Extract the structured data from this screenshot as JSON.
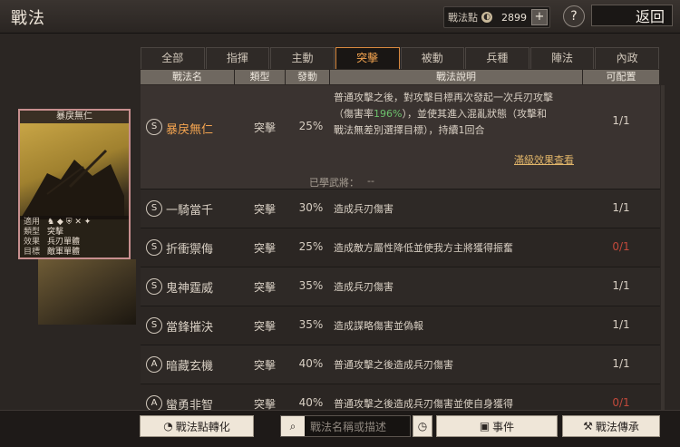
{
  "header": {
    "title": "戰法",
    "points_label": "戰法點",
    "points_value": "2899",
    "points_plus": "+",
    "help": "?",
    "back_label": "返回"
  },
  "tabs": [
    "全部",
    "指揮",
    "主動",
    "突擊",
    "被動",
    "兵種",
    "陣法",
    "內政"
  ],
  "active_tab": "突擊",
  "columns": [
    "戰法名",
    "類型",
    "發動",
    "戰法說明",
    "可配置"
  ],
  "expanded": {
    "badge": "S",
    "name": "暴戾無仁",
    "type": "突擊",
    "rate": "25%",
    "desc_1": "普通攻擊之後，對攻擊目標再次發起一次兵刃攻擊",
    "desc_2a": "（傷害率",
    "desc_2b": "196%",
    "desc_2c": "），並使其進入混亂狀態（攻擊和",
    "desc_3": "戰法無差別選擇目標），持續1回合",
    "config": "1/1",
    "full_effect_link": "滿級效果查看",
    "learned_label": "已學武將：",
    "learned_value": "--"
  },
  "rows": [
    {
      "badge": "S",
      "name": "一騎當千",
      "type": "突擊",
      "rate": "30%",
      "desc": "造成兵刃傷害",
      "config": "1/1",
      "red": false
    },
    {
      "badge": "S",
      "name": "折衝禦侮",
      "type": "突擊",
      "rate": "25%",
      "desc": "造成敵方屬性降低並使我方主將獲得振奮",
      "config": "0/1",
      "red": true
    },
    {
      "badge": "S",
      "name": "鬼神霆威",
      "type": "突擊",
      "rate": "35%",
      "desc": "造成兵刃傷害",
      "config": "1/1",
      "red": false
    },
    {
      "badge": "S",
      "name": "當鋒摧決",
      "type": "突擊",
      "rate": "35%",
      "desc": "造成謀略傷害並偽報",
      "config": "1/1",
      "red": false
    },
    {
      "badge": "A",
      "name": "暗藏玄機",
      "type": "突擊",
      "rate": "40%",
      "desc": "普通攻擊之後造成兵刃傷害",
      "config": "1/1",
      "red": false
    },
    {
      "badge": "A",
      "name": "蠻勇非智",
      "type": "突擊",
      "rate": "40%",
      "desc": "普通攻擊之後造成兵刃傷害並使自身獲得",
      "config": "0/1",
      "red": true
    }
  ],
  "detail_card": {
    "title": "暴戾無仁",
    "apply_label": "適用",
    "apply_icons": "♞ ◆ ⛨ ✕ ✦",
    "type_label": "類型",
    "type_value": "突擊",
    "effect_label": "效果",
    "effect_value": "兵刃單體",
    "target_label": "目標",
    "target_value": "敵軍單體"
  },
  "bottom": {
    "convert_label": "戰法點轉化",
    "search_placeholder": "戰法名稱或描述",
    "event_label": "事件",
    "inherit_label": "戰法傳承"
  },
  "colors": {
    "accent": "#f3a450",
    "green": "#6cc16c",
    "red": "#c2493b"
  }
}
